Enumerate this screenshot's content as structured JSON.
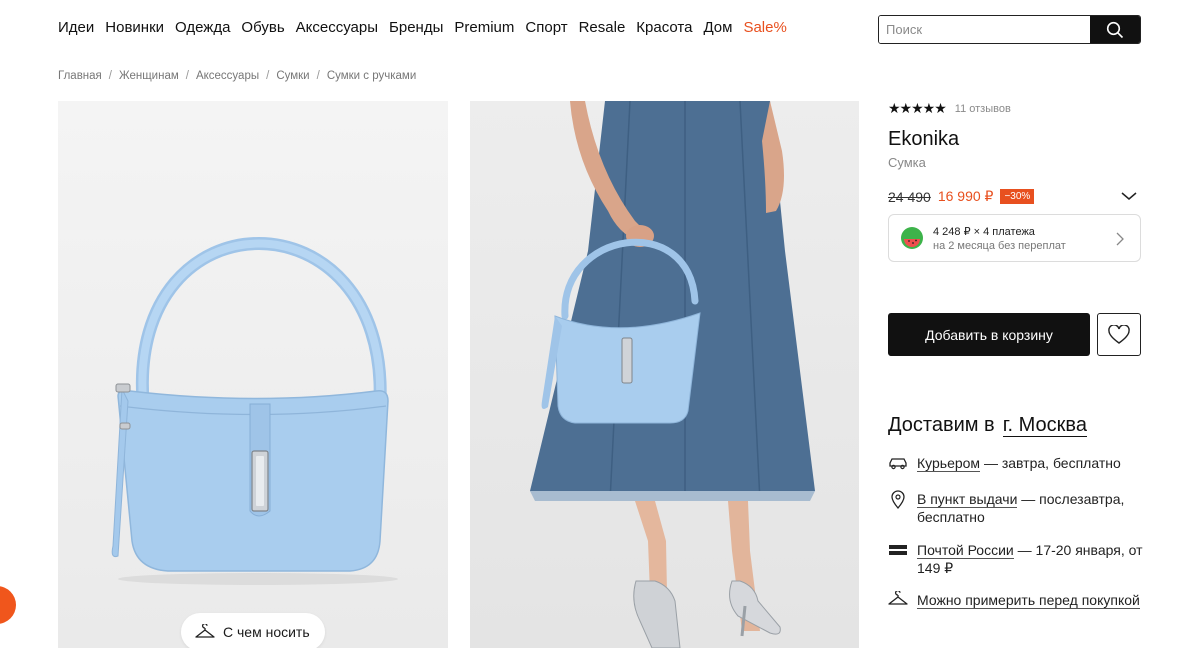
{
  "nav": {
    "items": [
      "Идеи",
      "Новинки",
      "Одежда",
      "Обувь",
      "Аксессуары",
      "Бренды",
      "Premium",
      "Спорт",
      "Resale",
      "Красота",
      "Дом"
    ],
    "sale": "Sale%"
  },
  "search": {
    "placeholder": "Поиск"
  },
  "breadcrumb": [
    "Главная",
    "Женщинам",
    "Аксессуары",
    "Сумки",
    "Сумки с ручками"
  ],
  "gallery": {
    "wear_button": "С чем носить"
  },
  "product": {
    "stars": "★★★★★",
    "reviews": "11 отзывов",
    "brand": "Ekonika",
    "type": "Сумка",
    "old_price": "24 490",
    "new_price": "16 990 ₽",
    "discount": "−30%",
    "split_line1": "4 248 ₽ × 4 платежа",
    "split_line2": "на 2 месяца без переплат",
    "add_to_cart": "Добавить в корзину"
  },
  "delivery": {
    "title": "Доставим в",
    "city": "г. Москва",
    "courier_link": "Курьером",
    "courier_rest": " — завтра, бесплатно",
    "pickup_link": "В пункт выдачи",
    "pickup_rest": " — послезавтра, бесплатно",
    "post_link": "Почтой России",
    "post_rest": " — 17-20 января, от 149 ₽",
    "fitting_link": "Можно примерить перед покупкой"
  },
  "colors": {
    "accent": "#e8501f",
    "dark": "#111111",
    "bag": "#a9cdee"
  }
}
